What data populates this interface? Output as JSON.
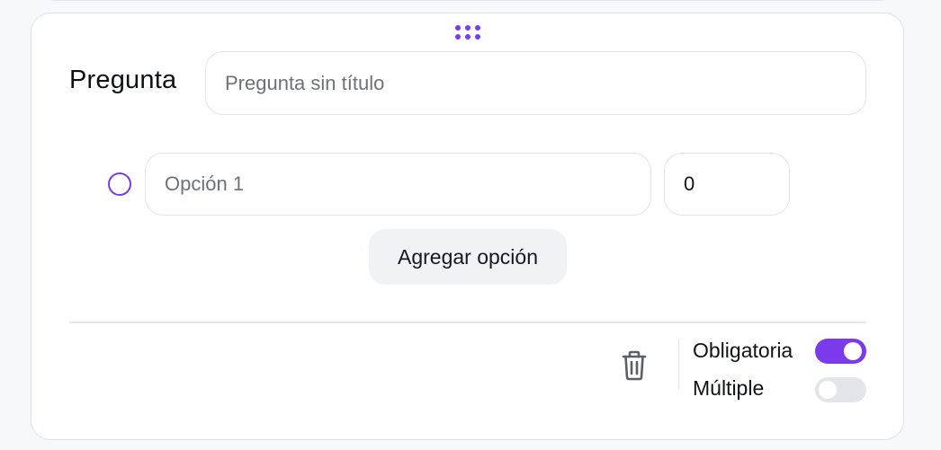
{
  "question": {
    "label": "Pregunta",
    "title_value": "",
    "title_placeholder": "Pregunta sin título"
  },
  "options": [
    {
      "value": "",
      "placeholder": "Opción 1",
      "score": "0"
    }
  ],
  "add_option_label": "Agregar opción",
  "footer": {
    "required": {
      "label": "Obligatoria",
      "on": true
    },
    "multiple": {
      "label": "Múltiple",
      "on": false
    }
  },
  "colors": {
    "accent": "#7c3aed",
    "toggle_off": "#e4e5e9",
    "button_bg": "#f1f2f4"
  },
  "icons": {
    "drag": "drag-handle-icon",
    "radio": "radio-icon",
    "delete": "trash-icon"
  }
}
